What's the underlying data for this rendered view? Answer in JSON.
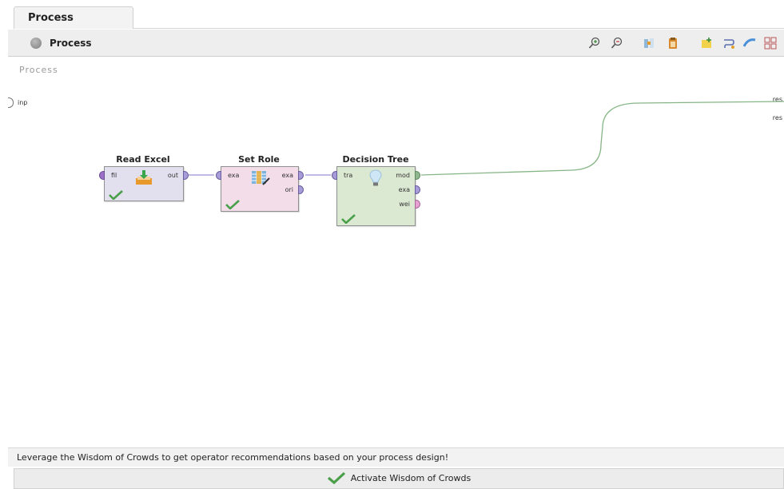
{
  "tab": {
    "label": "Process"
  },
  "header": {
    "title": "Process",
    "toolbar": [
      "zoom-in-icon",
      "zoom-out-icon",
      "auto-fit-icon",
      "paste-icon",
      "add-note-icon",
      "auto-wire-icon",
      "wire-icon",
      "arrange-icon"
    ]
  },
  "canvas": {
    "label": "Process",
    "input_port": "inp",
    "result_ports": [
      "res",
      "res"
    ],
    "operators": [
      {
        "name": "Read Excel",
        "ports_in": [
          "fil"
        ],
        "ports_out": [
          "out"
        ],
        "color": "#e2e0ee",
        "status": "ok"
      },
      {
        "name": "Set Role",
        "ports_in": [
          "exa"
        ],
        "ports_out": [
          "exa",
          "ori"
        ],
        "color": "#f2dde8",
        "status": "ok"
      },
      {
        "name": "Decision Tree",
        "ports_in": [
          "tra"
        ],
        "ports_out": [
          "mod",
          "exa",
          "wei"
        ],
        "color": "#dce9d2",
        "status": "ok"
      }
    ]
  },
  "recommendation": {
    "hint": "Leverage the Wisdom of Crowds to get operator recommendations based on your process design!",
    "button": "Activate Wisdom of Crowds"
  },
  "colors": {
    "connection_example": "#9c90d4",
    "connection_model": "#86b586",
    "check": "#4aa04a"
  }
}
